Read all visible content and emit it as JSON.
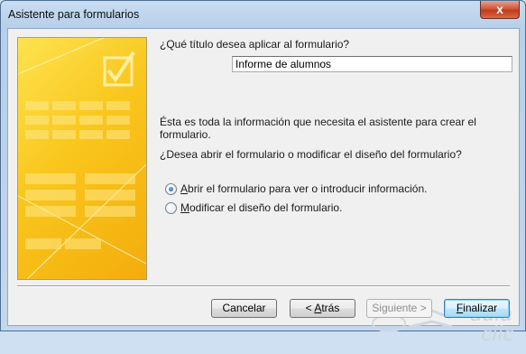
{
  "window": {
    "title": "Asistente para formularios",
    "close_glyph": "x"
  },
  "content": {
    "question_title": "¿Qué título desea aplicar al formulario?",
    "title_value": "Informe de alumnos",
    "info": "Ésta es toda la información que necesita el asistente para crear el formulario.",
    "question_open": "¿Desea abrir el formulario o modificar el diseño del formulario?"
  },
  "options": [
    {
      "key": "A",
      "rest": "brir el formulario para ver o introducir información.",
      "selected": true
    },
    {
      "key": "M",
      "rest": "odificar el diseño del formulario.",
      "selected": false
    }
  ],
  "buttons": {
    "cancel": "Cancelar",
    "back_prefix": "< ",
    "back_key": "A",
    "back_rest": "trás",
    "next": "Siguiente >",
    "finish_key": "F",
    "finish_rest": "inalizar"
  },
  "watermark": {
    "line1": "aula",
    "line2": "clic"
  },
  "colors": {
    "panel_yellow": "#f9c61d",
    "close_red": "#c03a1d",
    "default_button_border": "#3c7fb1"
  }
}
